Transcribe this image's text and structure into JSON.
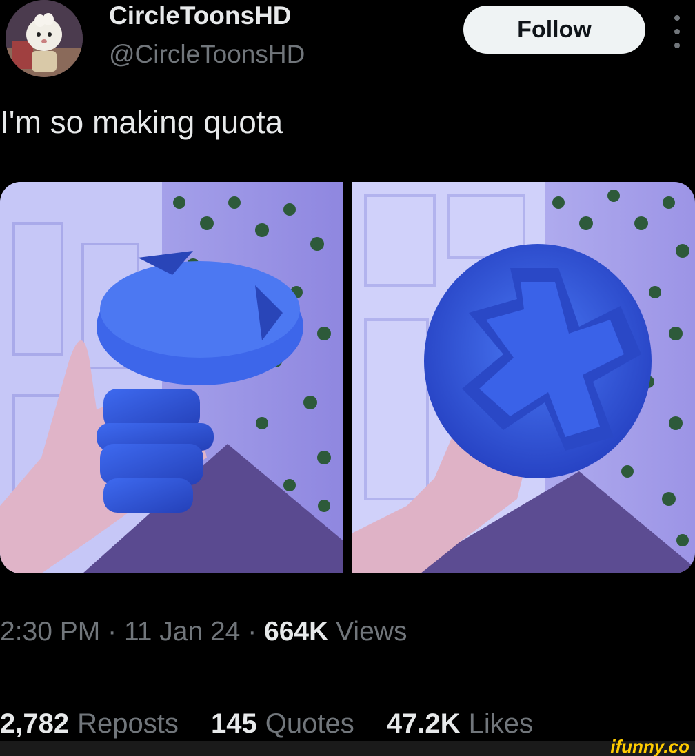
{
  "author": {
    "display_name": "CircleToonsHD",
    "handle": "@CircleToonsHD",
    "avatar_icon": "avatar-icon"
  },
  "actions": {
    "follow_label": "Follow",
    "more_icon": "more-vertical-icon"
  },
  "tweet": {
    "text": "I'm so making quota"
  },
  "media": {
    "photos": [
      {
        "icon": "photo-icon"
      },
      {
        "icon": "photo-icon"
      }
    ]
  },
  "meta": {
    "time": "2:30 PM",
    "separator": "·",
    "date": "11 Jan 24",
    "views_count": "664K",
    "views_label": "Views"
  },
  "stats": {
    "reposts_count": "2,782",
    "reposts_label": "Reposts",
    "quotes_count": "145",
    "quotes_label": "Quotes",
    "likes_count": "47.2K",
    "likes_label": "Likes"
  },
  "watermark": {
    "text": "ifunny.co"
  },
  "colors": {
    "background": "#000000",
    "text_primary": "#e7e9ea",
    "text_secondary": "#71767b",
    "follow_bg": "#eff3f4",
    "divider": "#2f3336",
    "object_blue": "#2f55d4",
    "wall_purple": "#8a84e6"
  }
}
